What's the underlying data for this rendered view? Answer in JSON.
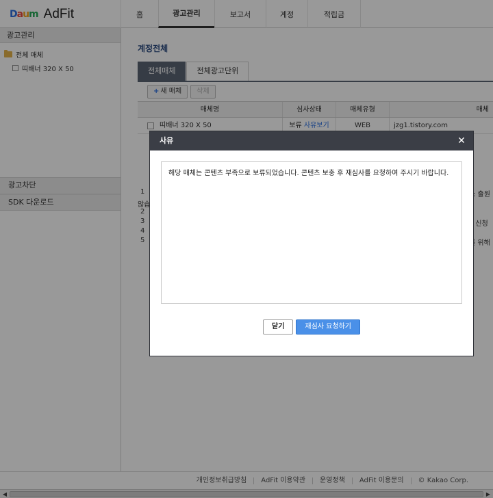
{
  "header": {
    "logo_daum": [
      "D",
      "a",
      "u",
      "m"
    ],
    "logo_adfit": "AdFit",
    "nav": [
      {
        "label": "홈"
      },
      {
        "label": "광고관리"
      },
      {
        "label": "보고서"
      },
      {
        "label": "계정"
      },
      {
        "label": "적립금"
      }
    ]
  },
  "sidebar": {
    "title": "광고관리",
    "tree": [
      {
        "label": "전체 매체"
      },
      {
        "label": "띠배너 320 X 50"
      }
    ],
    "section_block": "광고차단",
    "section_sdk": "SDK 다운로드"
  },
  "main": {
    "title": "계정전체",
    "tabs": [
      {
        "label": "전체매체"
      },
      {
        "label": "전체광고단위"
      }
    ],
    "toolbar": {
      "add": "새 매체",
      "delete": "삭제"
    },
    "grid": {
      "headers": [
        "매체명",
        "심사상태",
        "매체유형",
        "매체"
      ],
      "rows": [
        {
          "name": "띠배너 320 X 50",
          "status": "보류",
          "reason_link": "사유보기",
          "type": "WEB",
          "url": "jzg1.tistory.com"
        }
      ]
    },
    "hints": {
      "n1": "1",
      "n2": "2",
      "n3": "3",
      "n4": "4",
      "n5": "5",
      "left_frag": "않습",
      "r1": ": 출원",
      "r3": "는 신청을",
      "r5": "를 위해"
    }
  },
  "modal": {
    "title": "사유",
    "message": "해당 매체는 콘텐츠 부족으로 보류되었습니다. 콘텐츠 보충 후 재심사를 요청하여 주시기 바랍니다.",
    "close_label": "닫기",
    "request_label": "재심사 요청하기"
  },
  "footer": {
    "links": [
      "개인정보취급방침",
      "AdFit 이용약관",
      "운영정책",
      "AdFit 이용문의",
      "© Kakao Corp."
    ]
  },
  "colors": {
    "tab_active": "#5b6474",
    "modal_header": "#3b3e46",
    "primary_button": "#4a90e8",
    "link": "#2a6ee0",
    "title": "#2d4d83"
  }
}
